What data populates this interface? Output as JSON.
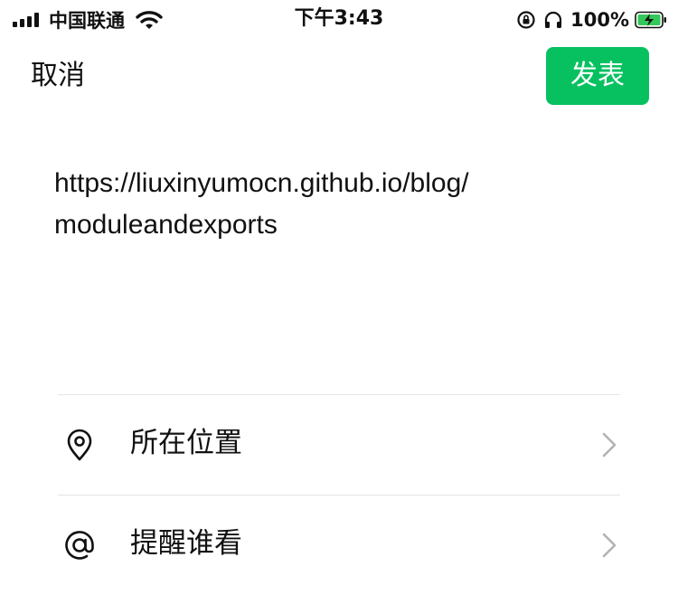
{
  "status_bar": {
    "carrier": "中国联通",
    "time": "下午3:43",
    "battery": "100%"
  },
  "nav": {
    "cancel_label": "取消",
    "publish_label": "发表"
  },
  "post": {
    "lines": [
      "https://liuxinyumocn.github.io/blog/",
      "moduleandexports"
    ]
  },
  "options": [
    {
      "label": "所在位置",
      "icon": "location-pin-icon"
    },
    {
      "label": "提醒谁看",
      "icon": "at-sign-icon"
    }
  ],
  "colors": {
    "accent": "#07c160",
    "divider": "#e5e5e5",
    "chevron": "#b2b2b2",
    "battery": "#34c759"
  }
}
